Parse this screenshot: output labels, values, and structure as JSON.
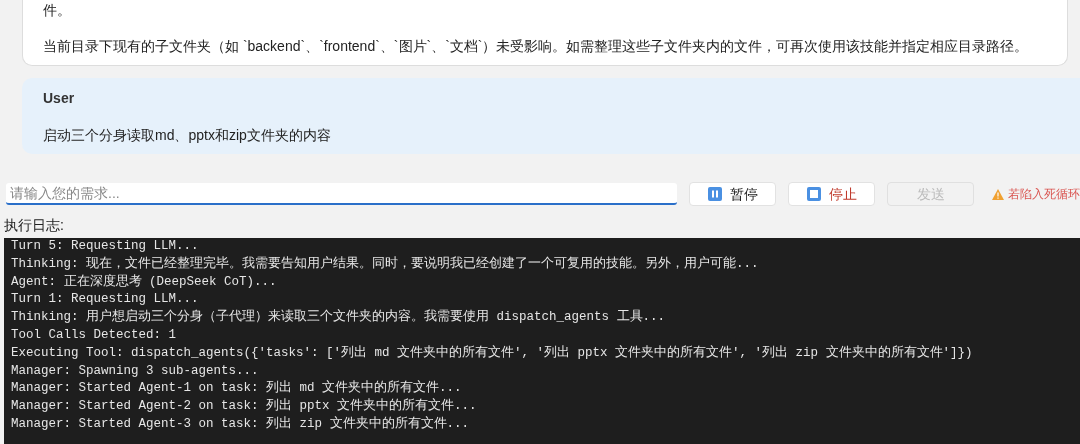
{
  "assistant_message": {
    "paragraphs": [
      "件。",
      "当前目录下现有的子文件夹（如 `backend`、`frontend`、`图片`、`文档`）未受影响。如需整理这些子文件夹内的文件，可再次使用该技能并指定相应目录路径。"
    ]
  },
  "user_message": {
    "role": "User",
    "text": "启动三个分身读取md、pptx和zip文件夹的内容"
  },
  "input": {
    "placeholder": "请输入您的需求..."
  },
  "buttons": [
    {
      "kind": "pause",
      "label": "暂停",
      "disabled": false
    },
    {
      "kind": "stop",
      "label": "停止",
      "disabled": false
    },
    {
      "kind": "send",
      "label": "发送",
      "disabled": true
    }
  ],
  "warning": "若陷入死循环",
  "log": {
    "label": "执行日志:",
    "lines": [
      "Turn 5: Requesting LLM...",
      "Thinking: 现在，文件已经整理完毕。我需要告知用户结果。同时，要说明我已经创建了一个可复用的技能。另外，用户可能...",
      "Agent: 正在深度思考 (DeepSeek CoT)...",
      "Turn 1: Requesting LLM...",
      "Thinking: 用户想启动三个分身（子代理）来读取三个文件夹的内容。我需要使用 dispatch_agents 工具...",
      "Tool Calls Detected: 1",
      "Executing Tool: dispatch_agents({'tasks': ['列出 md 文件夹中的所有文件', '列出 pptx 文件夹中的所有文件', '列出 zip 文件夹中的所有文件']})",
      "Manager: Spawning 3 sub-agents...",
      "Manager: Started Agent-1 on task: 列出 md 文件夹中的所有文件...",
      "Manager: Started Agent-2 on task: 列出 pptx 文件夹中的所有文件...",
      "Manager: Started Agent-3 on task: 列出 zip 文件夹中的所有文件..."
    ]
  }
}
